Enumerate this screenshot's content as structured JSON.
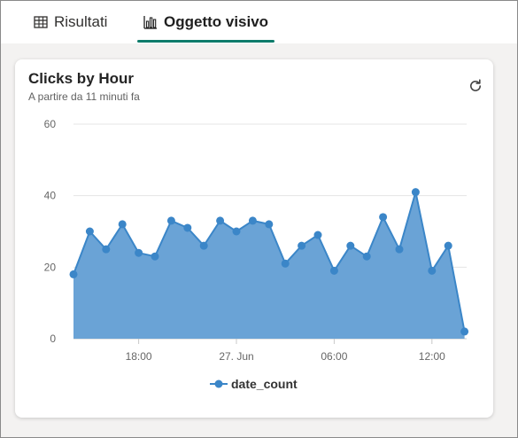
{
  "tabs": [
    {
      "label": "Risultati",
      "icon": "table-icon",
      "active": false
    },
    {
      "label": "Oggetto visivo",
      "icon": "bar-chart-icon",
      "active": true
    }
  ],
  "card": {
    "title": "Clicks by Hour",
    "subtitle": "A partire da 11 minuti fa",
    "refresh_icon": "refresh-icon"
  },
  "colors": {
    "series": "#3b86c8",
    "area": "#6aa3d6",
    "accent": "#0e7c6b",
    "grid": "#e5e5e5"
  },
  "chart_data": {
    "type": "area",
    "title": "Clicks by Hour",
    "xlabel": "",
    "ylabel": "",
    "ylim": [
      0,
      60
    ],
    "yticks": [
      0,
      20,
      40,
      60
    ],
    "xticks": [
      {
        "label": "18:00",
        "index": 4
      },
      {
        "label": "27. Jun",
        "index": 10
      },
      {
        "label": "06:00",
        "index": 16
      },
      {
        "label": "12:00",
        "index": 22
      }
    ],
    "grid": true,
    "legend": "bottom-center",
    "series": [
      {
        "name": "date_count",
        "values": [
          18,
          30,
          25,
          32,
          24,
          23,
          33,
          31,
          26,
          33,
          30,
          33,
          32,
          21,
          26,
          29,
          19,
          26,
          23,
          34,
          25,
          41,
          19,
          26,
          2
        ]
      }
    ]
  }
}
